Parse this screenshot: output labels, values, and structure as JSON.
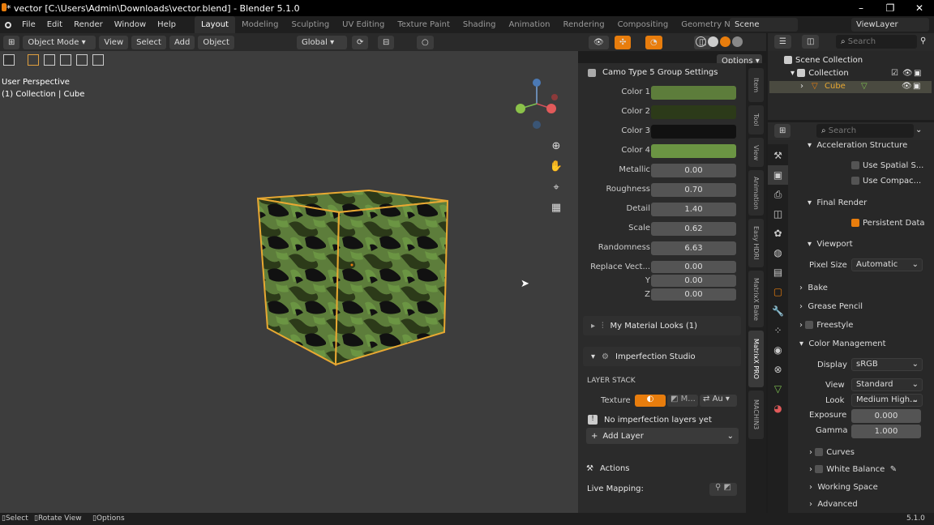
{
  "window": {
    "title": "* vector [C:\\Users\\Admin\\Downloads\\vector.blend] - Blender 5.1.0"
  },
  "menus": [
    "File",
    "Edit",
    "Render",
    "Window",
    "Help"
  ],
  "workspaces": [
    "Layout",
    "Modeling",
    "Sculpting",
    "UV Editing",
    "Texture Paint",
    "Shading",
    "Animation",
    "Rendering",
    "Compositing",
    "Geometry Nodes"
  ],
  "scene": "Scene",
  "view_layer": "ViewLayer",
  "vp": {
    "mode": "Object Mode",
    "view": "View",
    "select": "Select",
    "add": "Add",
    "object": "Object",
    "transform": "Global",
    "options": "Options",
    "perspective": "User Perspective",
    "collection_info": "(1) Collection | Cube"
  },
  "npanel": {
    "group_title": "Camo Type 5 Group Settings",
    "colors": [
      {
        "label": "Color 1",
        "hex": "#5d7d3b"
      },
      {
        "label": "Color 2",
        "hex": "#2c3a19"
      },
      {
        "label": "Color 3",
        "hex": "#111111"
      },
      {
        "label": "Color 4",
        "hex": "#6b9543"
      }
    ],
    "sliders": [
      {
        "label": "Metallic",
        "value": "0.00",
        "fill": 0
      },
      {
        "label": "Roughness",
        "value": "0.70",
        "fill": 0.7
      },
      {
        "label": "Detail",
        "value": "1.40",
        "fill": 0.05
      },
      {
        "label": "Scale",
        "value": "0.62",
        "fill": 0.03
      },
      {
        "label": "Randomness",
        "value": "6.63",
        "fill": 0.05
      }
    ],
    "vector": {
      "label": "Replace Vect...",
      "x": "0.00",
      "y_label": "Y",
      "y": "0.00",
      "z_label": "Z",
      "z": "0.00"
    },
    "looks": "My Material Looks (1)",
    "imperfection": "Imperfection Studio",
    "layer_stack": "LAYER STACK",
    "texture_label": "Texture",
    "tex_m": "M...",
    "tex_au": "Au",
    "no_layers": "No imperfection layers yet",
    "add_layer": "Add Layer",
    "actions": "Actions",
    "live_mapping": "Live Mapping:"
  },
  "sidetabs": [
    "Item",
    "Tool",
    "View",
    "Animation",
    "Easy HDRI",
    "MatrixX Bake",
    "MatrixX PRO",
    "MACHIN3"
  ],
  "outliner": {
    "search": "Search",
    "scene_collection": "Scene Collection",
    "collection": "Collection",
    "cube": "Cube"
  },
  "props": {
    "search": "Search",
    "accel": "Acceleration Structure",
    "use_spatial": "Use Spatial S...",
    "use_compact": "Use Compac...",
    "final_render": "Final Render",
    "persistent": "Persistent Data",
    "viewport": "Viewport",
    "pixel_size_label": "Pixel Size",
    "pixel_size": "Automatic",
    "bake": "Bake",
    "grease": "Grease Pencil",
    "freestyle": "Freestyle",
    "color_mgmt": "Color Management",
    "display_label": "Display",
    "display": "sRGB",
    "view_label": "View",
    "view": "Standard",
    "look_label": "Look",
    "look": "Medium High...",
    "exposure_label": "Exposure",
    "exposure": "0.000",
    "gamma_label": "Gamma",
    "gamma": "1.000",
    "curves": "Curves",
    "white_balance": "White Balance",
    "working_space": "Working Space",
    "advanced": "Advanced"
  },
  "status": {
    "select": "Select",
    "rotate": "Rotate View",
    "options": "Options",
    "version": "5.1.0"
  }
}
